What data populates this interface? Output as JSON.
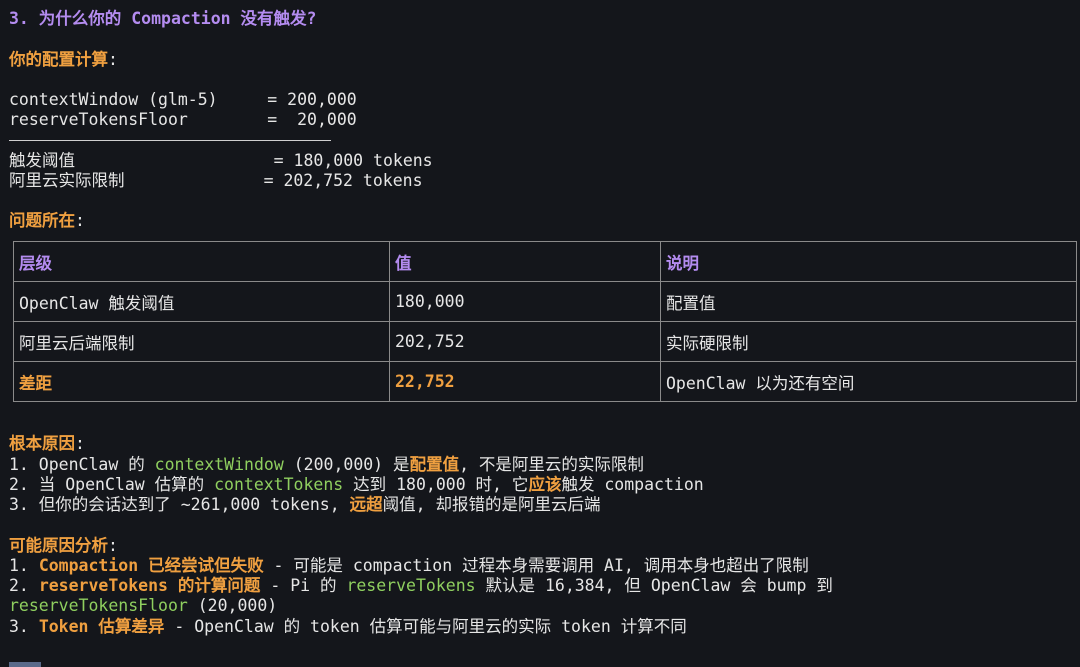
{
  "section_title": "3. 为什么你的 Compaction 没有触发?",
  "config_heading": "你的配置计算",
  "config_lines": [
    "contextWindow (glm-5)     = 200,000",
    "reserveTokensFloor        =  20,000",
    "触发阈值                    = 180,000 tokens",
    "阿里云实际限制              = 202,752 tokens"
  ],
  "problem_heading": "问题所在",
  "table": {
    "headers": [
      "层级",
      "值",
      "说明"
    ],
    "rows": [
      [
        "OpenClaw 触发阈值",
        "180,000",
        "配置值"
      ],
      [
        "阿里云后端限制",
        "202,752",
        "实际硬限制"
      ],
      [
        "差距",
        "22,752",
        "OpenClaw 以为还有空间"
      ]
    ]
  },
  "root_cause": {
    "heading": "根本原因",
    "l1": {
      "a": "1. OpenClaw 的 ",
      "g": "contextWindow",
      "b": " (200,000) 是",
      "o": "配置值",
      "c": ", 不是阿里云的实际限制"
    },
    "l2": {
      "a": "2. 当 OpenClaw 估算的 ",
      "g": "contextTokens",
      "b": " 达到 180,000 时, 它",
      "o": "应该",
      "c": "触发 compaction"
    },
    "l3": {
      "a": "3. 但你的会话达到了 ~261,000 tokens, ",
      "o": "远超",
      "c": "阈值, 却报错的是阿里云后端"
    }
  },
  "possible": {
    "heading": "可能原因分析",
    "l1": {
      "n": "1. ",
      "o": "Compaction 已经尝试但失败",
      "c": " - 可能是 compaction 过程本身需要调用 AI, 调用本身也超出了限制"
    },
    "l2": {
      "n": "2. ",
      "o": "reserveTokens 的计算问题",
      "b": " - Pi 的 ",
      "g": "reserveTokens",
      "c": " 默认是 16,384, 但 OpenClaw 会 bump 到"
    },
    "l2b": {
      "g": "reserveTokensFloor",
      "c": " (20,000)"
    },
    "l3": {
      "n": "3. ",
      "o": "Token 估算差异",
      "c": " - OpenClaw 的 token 估算可能与阿里云的实际 token 计算不同"
    }
  },
  "colon": ":",
  "colors": {
    "heading_purple": "#b48cf0",
    "accent_orange": "#f0a040",
    "code_green": "#8fcf5f",
    "background": "#14161b"
  }
}
